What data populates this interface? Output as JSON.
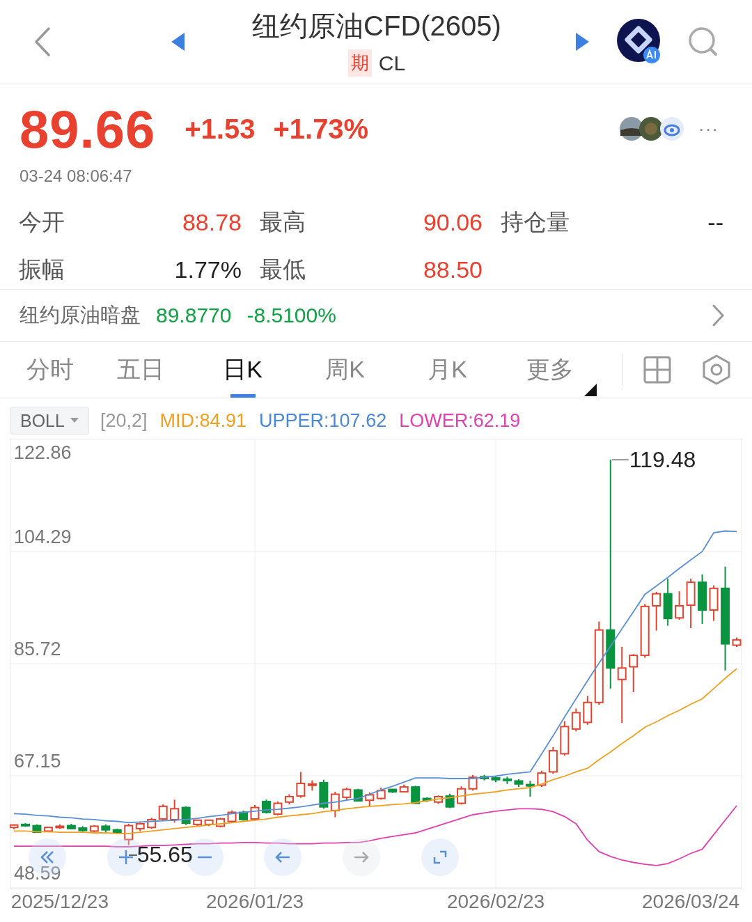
{
  "header": {
    "title": "纽约原油CFD(2605)",
    "market_badge": "期",
    "code": "CL"
  },
  "quote": {
    "price": "89.66",
    "change": "+1.53",
    "change_pct": "+1.73%",
    "time": "03-24 08:06:47",
    "more": "···"
  },
  "stats": [
    {
      "label": "今开",
      "value": "88.78",
      "color": "#e8412f"
    },
    {
      "label": "最高",
      "value": "90.06",
      "color": "#e8412f"
    },
    {
      "label": "持仓量",
      "value": "--",
      "color": "#222222"
    },
    {
      "label": "振幅",
      "value": "1.77%",
      "color": "#222222"
    },
    {
      "label": "最低",
      "value": "88.50",
      "color": "#e8412f"
    }
  ],
  "dark_pool": {
    "label": "纽约原油暗盘",
    "price": "89.8770",
    "change_pct": "-8.5100%",
    "color": "#12a045"
  },
  "tabs": [
    {
      "label": "分时",
      "selected": false
    },
    {
      "label": "五日",
      "selected": false
    },
    {
      "label": "日K",
      "selected": true
    },
    {
      "label": "周K",
      "selected": false
    },
    {
      "label": "月K",
      "selected": false
    },
    {
      "label": "更多",
      "selected": false
    }
  ],
  "indicator": {
    "name": "BOLL",
    "params": "[20,2]",
    "values": [
      {
        "value": ":84.91",
        "color": "#f0a020"
      },
      {
        "value": ":107.62",
        "color": "#4a88d8"
      },
      {
        "value": ":62.19",
        "color": "#e040b0"
      }
    ]
  },
  "chart": {
    "top_label": "122.86",
    "max_label": "119.48",
    "min_label": "55.65",
    "controls": [
      {
        "kind": "rewind",
        "disabled": false
      },
      {
        "kind": "zoom-in",
        "disabled": false
      },
      {
        "kind": "zoom-out",
        "disabled": false
      },
      {
        "kind": "left",
        "disabled": false
      },
      {
        "kind": "right",
        "disabled": true
      },
      {
        "kind": "fullscreen",
        "disabled": false
      }
    ],
    "chart_data": {
      "type": "candlestick",
      "grid": true,
      "ylim": [
        48.59,
        122.86
      ],
      "yticks": [
        {
          "value": 104.29,
          "label": "104.29"
        },
        {
          "value": 85.72,
          "label": "85.72"
        },
        {
          "value": 67.15,
          "label": "67.15"
        },
        {
          "value": 48.59,
          "label": "48.59"
        }
      ],
      "categories": [
        null,
        null,
        null,
        null,
        "2025/12/23",
        null,
        null,
        null,
        null,
        null,
        null,
        null,
        null,
        null,
        null,
        null,
        null,
        null,
        null,
        null,
        null,
        "2026/01/23",
        null,
        null,
        null,
        null,
        null,
        null,
        null,
        null,
        null,
        null,
        null,
        null,
        null,
        null,
        null,
        null,
        null,
        null,
        null,
        null,
        "2026/02/23",
        null,
        null,
        null,
        null,
        null,
        null,
        null,
        null,
        null,
        null,
        null,
        null,
        null,
        null,
        null,
        null,
        "2026/03/24",
        null,
        null,
        null,
        null
      ],
      "series": [
        {
          "name": "MID",
          "type": "line",
          "color": "#f0a020",
          "values": [
            58.0,
            58.0,
            57.9,
            57.9,
            57.8,
            57.8,
            57.8,
            57.7,
            57.7,
            57.6,
            57.6,
            57.8,
            58.0,
            58.2,
            58.4,
            58.6,
            58.8,
            59.0,
            59.2,
            59.4,
            59.6,
            59.8,
            60.0,
            60.3,
            60.5,
            60.7,
            60.9,
            61.2,
            61.4,
            61.7,
            61.9,
            62.1,
            62.2,
            62.4,
            62.5,
            62.7,
            63.0,
            63.3,
            63.5,
            63.8,
            64.1,
            64.3,
            64.5,
            64.8,
            65.0,
            65.2,
            65.8,
            66.5,
            67.1,
            67.8,
            68.4,
            69.8,
            71.1,
            72.5,
            73.8,
            75.2,
            76.1,
            77.1,
            78.0,
            79.0,
            79.9,
            81.6,
            83.3,
            84.9
          ]
        },
        {
          "name": "UPPER",
          "type": "line",
          "color": "#5b8fd4",
          "values": [
            60.9,
            60.8,
            60.6,
            60.5,
            60.3,
            60.2,
            60.0,
            59.9,
            59.7,
            59.6,
            59.4,
            59.5,
            59.6,
            59.7,
            59.8,
            59.9,
            60.1,
            60.4,
            60.6,
            60.9,
            61.1,
            61.3,
            61.5,
            61.6,
            61.8,
            62.0,
            62.3,
            62.6,
            62.8,
            63.1,
            63.4,
            64.1,
            64.8,
            65.4,
            66.1,
            66.8,
            66.8,
            66.8,
            66.7,
            66.7,
            66.7,
            66.9,
            67.1,
            67.4,
            67.6,
            67.8,
            70.8,
            73.8,
            76.9,
            79.9,
            82.9,
            85.8,
            88.6,
            91.5,
            94.3,
            97.2,
            98.6,
            100.0,
            101.5,
            102.9,
            104.3,
            107.4,
            107.7,
            107.6
          ]
        },
        {
          "name": "LOWER",
          "type": "line",
          "color": "#e040b0",
          "values": [
            55.5,
            55.5,
            55.5,
            55.5,
            55.5,
            55.5,
            55.5,
            55.5,
            55.5,
            55.4,
            55.4,
            55.5,
            55.6,
            55.6,
            55.7,
            55.8,
            55.9,
            55.9,
            56.0,
            56.0,
            56.1,
            56.1,
            56.0,
            56.0,
            55.9,
            55.9,
            55.9,
            56.0,
            56.0,
            56.1,
            56.1,
            56.4,
            56.8,
            57.1,
            57.4,
            57.7,
            58.3,
            58.9,
            59.5,
            60.1,
            60.7,
            61.0,
            61.3,
            61.5,
            61.7,
            61.7,
            61.6,
            61.2,
            60.4,
            59.2,
            56.5,
            54.6,
            53.8,
            53.2,
            52.8,
            52.5,
            52.3,
            52.6,
            53.4,
            54.3,
            55.0,
            57.4,
            59.8,
            62.2
          ]
        }
      ],
      "ohlc": [
        [
          58.6,
          59.1,
          58.3,
          59.0
        ],
        [
          59.1,
          59.3,
          58.7,
          58.9
        ],
        [
          58.9,
          59.1,
          57.7,
          57.8
        ],
        [
          58.0,
          58.7,
          57.8,
          58.6
        ],
        [
          58.6,
          59.1,
          58.4,
          58.8
        ],
        [
          58.9,
          59.2,
          58.3,
          58.4
        ],
        [
          58.5,
          58.8,
          57.9,
          58.1
        ],
        [
          58.0,
          59.0,
          57.7,
          58.8
        ],
        [
          58.8,
          59.1,
          57.8,
          58.2
        ],
        [
          58.2,
          58.4,
          57.5,
          57.7
        ],
        [
          56.6,
          59.2,
          55.65,
          58.9
        ],
        [
          58.4,
          59.4,
          58.0,
          59.2
        ],
        [
          58.6,
          60.2,
          58.4,
          59.9
        ],
        [
          60.0,
          62.4,
          59.7,
          62.1
        ],
        [
          59.9,
          63.2,
          59.4,
          61.7
        ],
        [
          61.9,
          62.1,
          59.0,
          59.3
        ],
        [
          59.1,
          59.9,
          58.8,
          59.8
        ],
        [
          59.1,
          59.9,
          58.8,
          59.8
        ],
        [
          58.8,
          60.2,
          58.6,
          60.0
        ],
        [
          59.6,
          61.4,
          59.4,
          61.1
        ],
        [
          61.1,
          61.4,
          59.7,
          59.9
        ],
        [
          60.0,
          62.3,
          59.8,
          61.9
        ],
        [
          62.9,
          63.2,
          60.9,
          61.1
        ],
        [
          60.8,
          62.9,
          60.6,
          62.6
        ],
        [
          62.8,
          64.1,
          62.4,
          63.7
        ],
        [
          63.8,
          67.8,
          63.5,
          65.9
        ],
        [
          65.6,
          66.4,
          64.7,
          65.8
        ],
        [
          66.0,
          66.5,
          61.7,
          62.0
        ],
        [
          61.4,
          64.5,
          60.3,
          64.1
        ],
        [
          63.6,
          65.2,
          63.1,
          64.9
        ],
        [
          64.8,
          65.0,
          62.9,
          63.0
        ],
        [
          63.1,
          64.4,
          62.2,
          64.0
        ],
        [
          63.4,
          65.2,
          63.2,
          64.7
        ],
        [
          64.9,
          65.0,
          64.3,
          64.5
        ],
        [
          64.5,
          65.7,
          64.4,
          65.3
        ],
        [
          65.3,
          65.5,
          62.5,
          62.6
        ],
        [
          63.4,
          63.6,
          62.8,
          63.1
        ],
        [
          62.8,
          63.9,
          62.5,
          63.7
        ],
        [
          63.8,
          64.2,
          61.8,
          62.0
        ],
        [
          62.6,
          65.4,
          62.4,
          65.0
        ],
        [
          65.0,
          67.3,
          64.7,
          66.9
        ],
        [
          67.0,
          67.3,
          66.4,
          66.7
        ],
        [
          66.8,
          67.1,
          66.1,
          66.5
        ],
        [
          66.6,
          67.0,
          65.8,
          66.4
        ],
        [
          66.3,
          66.6,
          65.3,
          65.8
        ],
        [
          65.7,
          66.3,
          63.7,
          65.6
        ],
        [
          65.6,
          68.0,
          65.3,
          67.6
        ],
        [
          67.8,
          71.9,
          67.5,
          71.3
        ],
        [
          70.8,
          76.2,
          70.5,
          75.3
        ],
        [
          74.9,
          78.3,
          74.5,
          77.6
        ],
        [
          76.0,
          80.4,
          75.6,
          79.3
        ],
        [
          79.3,
          92.7,
          78.9,
          91.3
        ],
        [
          91.3,
          119.48,
          81.6,
          85.0
        ],
        [
          83.1,
          88.5,
          75.9,
          85.0
        ],
        [
          85.2,
          87.3,
          81.0,
          87.1
        ],
        [
          87.1,
          95.6,
          86.7,
          95.2
        ],
        [
          95.3,
          97.6,
          91.2,
          97.3
        ],
        [
          97.3,
          99.8,
          92.0,
          93.2
        ],
        [
          93.3,
          97.7,
          93.0,
          95.3
        ],
        [
          95.4,
          99.8,
          91.6,
          99.2
        ],
        [
          99.2,
          100.5,
          92.3,
          94.6
        ],
        [
          94.6,
          98.7,
          92.8,
          98.2
        ],
        [
          98.2,
          101.8,
          84.6,
          89.0
        ],
        [
          88.78,
          90.06,
          88.5,
          89.66
        ]
      ]
    }
  }
}
